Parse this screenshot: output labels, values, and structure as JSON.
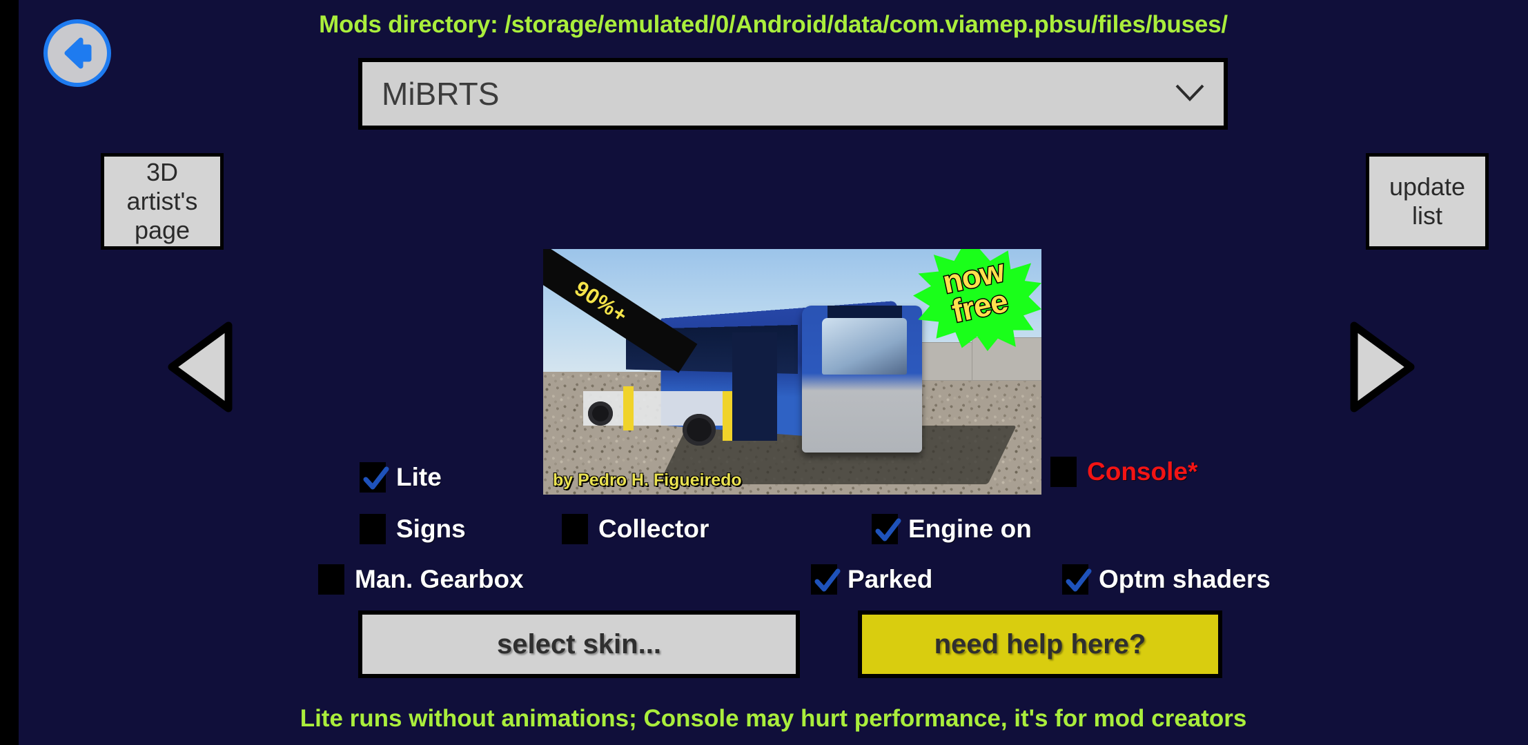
{
  "app": {
    "background_color": "#100f3a",
    "accent_green": "#aaee3c",
    "accent_red": "#f31414",
    "accent_yellow": "#d9cd0f",
    "accent_blue": "#1e7bf0"
  },
  "header": {
    "mods_directory": "Mods directory: /storage/emulated/0/Android/data/com.viamep.pbsu/files/buses/"
  },
  "back_button": {
    "icon": "arrow-left-icon"
  },
  "mod_selector": {
    "selected": "MiBRTS",
    "chevron": "chevron-down-icon"
  },
  "side_buttons": {
    "artist": {
      "line1": "3D",
      "line2": "artist's",
      "line3": "page"
    },
    "update": {
      "line1": "update",
      "line2": "list"
    }
  },
  "nav": {
    "prev": "previous-mod-arrow",
    "next": "next-mod-arrow"
  },
  "preview": {
    "badge_corner": "90%+",
    "badge_star_line1": "now",
    "badge_star_line2": "free",
    "credit": "by Pedro H. Figueiredo"
  },
  "options": [
    {
      "id": "lite",
      "label": "Lite",
      "checked": true,
      "warn": false
    },
    {
      "id": "console",
      "label": "Console*",
      "checked": false,
      "warn": true
    },
    {
      "id": "signs",
      "label": "Signs",
      "checked": false,
      "warn": false
    },
    {
      "id": "collector",
      "label": "Collector",
      "checked": false,
      "warn": false
    },
    {
      "id": "engine_on",
      "label": "Engine on",
      "checked": true,
      "warn": false
    },
    {
      "id": "man_gearbox",
      "label": "Man. Gearbox",
      "checked": false,
      "warn": false
    },
    {
      "id": "parked",
      "label": "Parked",
      "checked": true,
      "warn": false
    },
    {
      "id": "optm_shaders",
      "label": "Optm shaders",
      "checked": true,
      "warn": false
    }
  ],
  "actions": {
    "select_skin": "select skin...",
    "need_help": "need help here?"
  },
  "footer": {
    "note": "Lite runs without animations; Console may hurt performance, it's for mod creators"
  }
}
